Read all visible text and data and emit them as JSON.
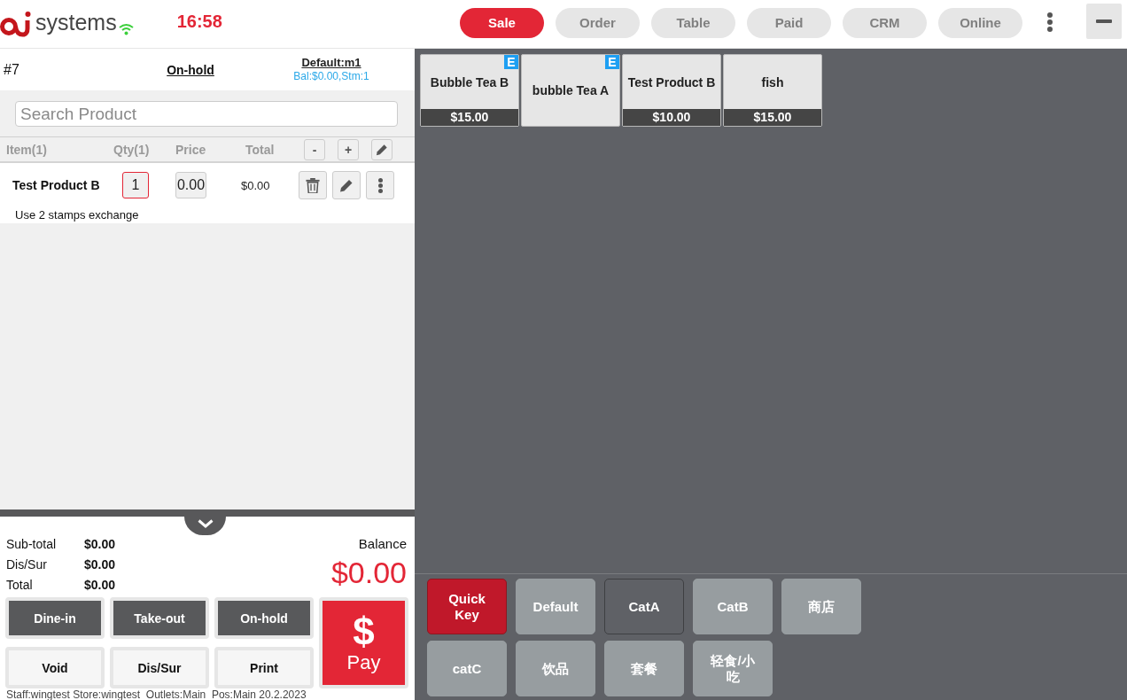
{
  "header": {
    "brand": "systems",
    "time": "16:58",
    "tabs": [
      {
        "label": "Sale",
        "selected": true
      },
      {
        "label": "Order",
        "selected": false
      },
      {
        "label": "Table",
        "selected": false
      },
      {
        "label": "Paid",
        "selected": false
      },
      {
        "label": "CRM",
        "selected": false
      },
      {
        "label": "Online",
        "selected": false
      }
    ]
  },
  "order": {
    "number": "#7",
    "status": "On-hold",
    "customer": "Default:m1",
    "customer_info": "Bal:$0.00,Stm:1"
  },
  "search": {
    "placeholder": "Search Product"
  },
  "cart": {
    "columns": [
      "Item(1)",
      "Qty(1)",
      "Price",
      "Total"
    ],
    "step_buttons": [
      "-",
      "+"
    ],
    "items": [
      {
        "name": "Test Product B",
        "qty": "1",
        "price": "0.00",
        "total": "$0.00",
        "note": "Use 2 stamps exchange"
      }
    ]
  },
  "totals": {
    "rows": [
      {
        "label": "Sub-total",
        "value": "$0.00"
      },
      {
        "label": "Dis/Sur",
        "value": "$0.00"
      },
      {
        "label": "Total",
        "value": "$0.00"
      }
    ],
    "balance_label": "Balance",
    "balance": "$0.00"
  },
  "actions": [
    {
      "label": "Dine-in",
      "kind": "dark"
    },
    {
      "label": "Take-out",
      "kind": "dark"
    },
    {
      "label": "On-hold",
      "kind": "dark"
    },
    {
      "label": "Void",
      "kind": "light"
    },
    {
      "label": "Dis/Sur",
      "kind": "light"
    },
    {
      "label": "Print",
      "kind": "light"
    }
  ],
  "pay": {
    "symbol": "$",
    "label": "Pay"
  },
  "status_line": "Staff:wingtest Store:wingtest  Outlets:Main  Pos:Main 20.2.2023",
  "products": [
    {
      "name": "Bubble Tea B",
      "badge": "E",
      "price": "$15.00"
    },
    {
      "name": "bubble Tea A",
      "badge": "E"
    },
    {
      "name": "Test Product B",
      "price": "$10.00"
    },
    {
      "name": "fish",
      "price": "$15.00"
    }
  ],
  "categories": [
    {
      "label": "Quick Key",
      "selected": true,
      "highlighted": false
    },
    {
      "label": "Default",
      "selected": false,
      "highlighted": false
    },
    {
      "label": "CatA",
      "selected": false,
      "highlighted": true
    },
    {
      "label": "CatB",
      "selected": false,
      "highlighted": false
    },
    {
      "label": "商店",
      "selected": false,
      "highlighted": false
    },
    {
      "label": "catC",
      "selected": false,
      "highlighted": false
    },
    {
      "label": "饮品",
      "selected": false,
      "highlighted": false
    },
    {
      "label": "套餐",
      "selected": false,
      "highlighted": false
    },
    {
      "label": "轻食/小吃",
      "selected": false,
      "highlighted": false
    }
  ]
}
